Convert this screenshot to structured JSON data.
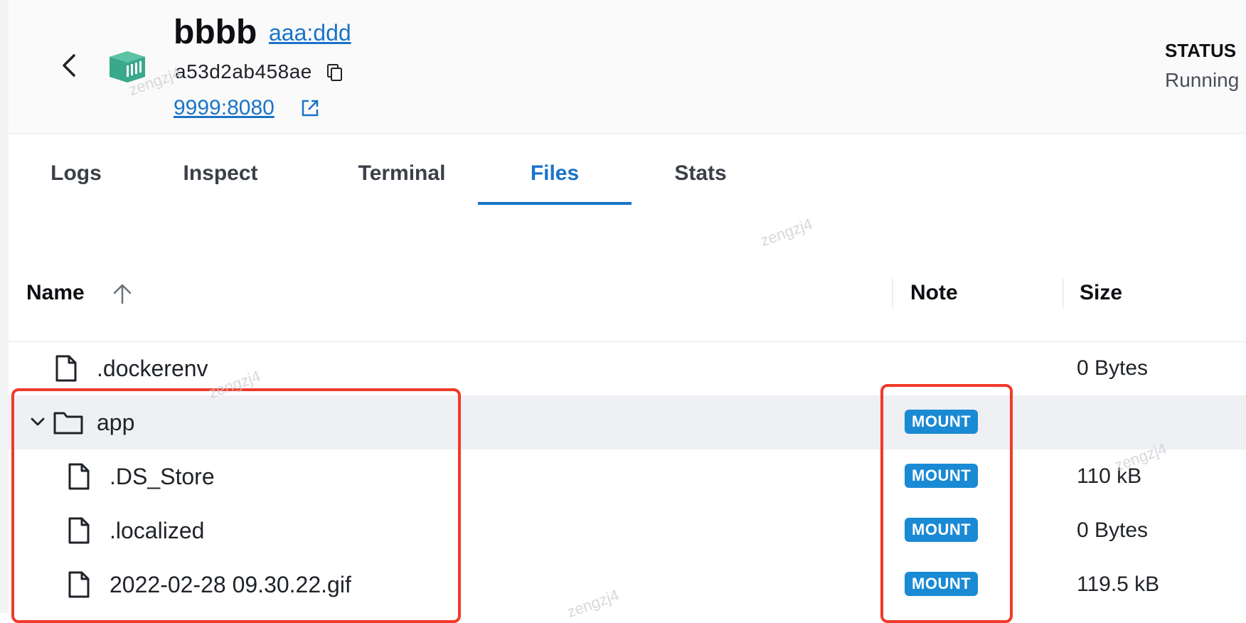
{
  "header": {
    "container_name": "bbbb",
    "image_tag": "aaa:ddd",
    "container_id": "a53d2ab458ae",
    "port_mapping": "9999:8080",
    "status_label": "STATUS",
    "status_value": "Running ("
  },
  "tabs": [
    {
      "label": "Logs",
      "active": false
    },
    {
      "label": "Inspect",
      "active": false
    },
    {
      "label": "Terminal",
      "active": false
    },
    {
      "label": "Files",
      "active": true
    },
    {
      "label": "Stats",
      "active": false
    }
  ],
  "table": {
    "columns": {
      "name": "Name",
      "note": "Note",
      "size": "Size"
    },
    "sort": {
      "column": "Name",
      "direction": "ascending",
      "icon": "arrow-up-icon"
    },
    "rows": [
      {
        "name": ".dockerenv",
        "type": "file",
        "note": "",
        "size": "0 Bytes"
      },
      {
        "name": "app",
        "type": "folder",
        "expanded": true,
        "note": "MOUNT",
        "size": ""
      },
      {
        "name": ".DS_Store",
        "type": "file",
        "indent": 1,
        "note": "MOUNT",
        "size": "110 kB"
      },
      {
        "name": ".localized",
        "type": "file",
        "indent": 1,
        "note": "MOUNT",
        "size": "0 Bytes"
      },
      {
        "name": "2022-02-28 09.30.22.gif",
        "type": "file",
        "indent": 1,
        "note": "MOUNT",
        "size": "119.5 kB"
      }
    ]
  },
  "watermark": "zengzj4",
  "colors": {
    "accent": "#1a73c9",
    "badge": "#1a8ad4",
    "highlight": "#f03a2a",
    "container_icon": "#3aa88a"
  }
}
